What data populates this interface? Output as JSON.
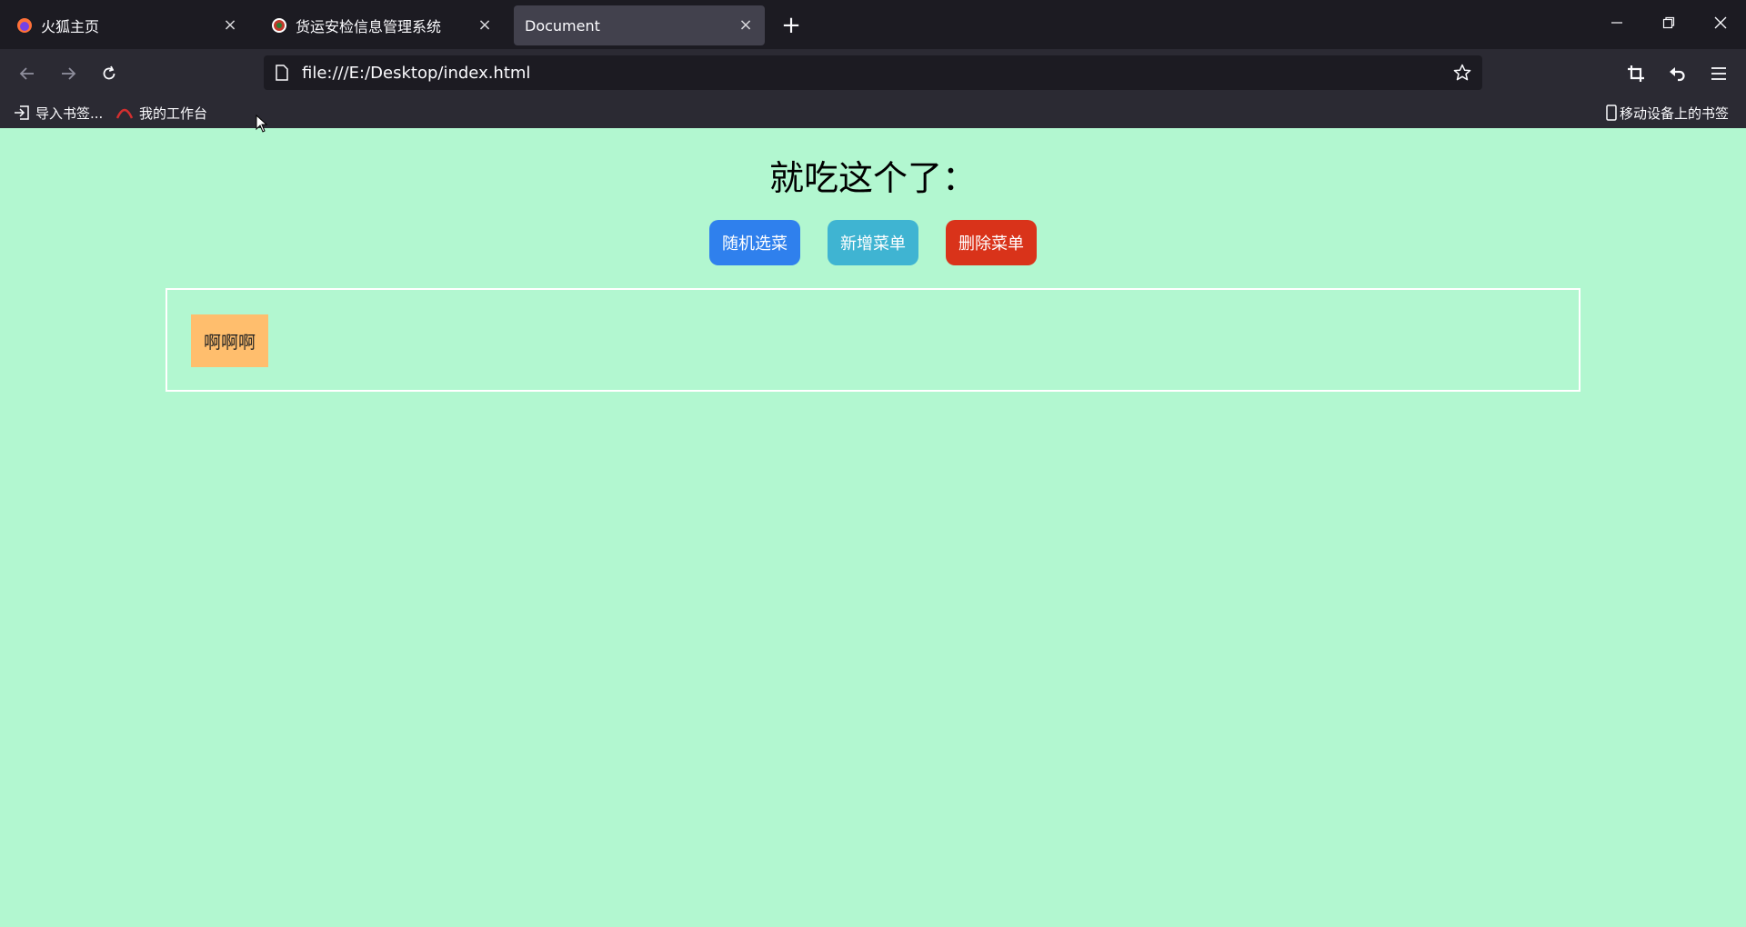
{
  "browser": {
    "tabs": [
      {
        "title": "火狐主页",
        "icon": "firefox-icon"
      },
      {
        "title": "货运安检信息管理系统",
        "icon": "site-logo-icon"
      },
      {
        "title": "Document",
        "icon": "none",
        "active": true
      }
    ],
    "url": "file:///E:/Desktop/index.html",
    "bookmarks": [
      {
        "label": "导入书签...",
        "icon": "import-icon"
      },
      {
        "label": "我的工作台",
        "icon": "workbench-icon"
      }
    ],
    "mobile_bookmarks": "移动设备上的书签"
  },
  "page": {
    "title": "就吃这个了：",
    "buttons": {
      "random": "随机选菜",
      "add": "新增菜单",
      "delete": "删除菜单"
    },
    "menu_items": [
      "啊啊啊"
    ]
  },
  "colors": {
    "page_bg": "#b2f7d0",
    "random_button": "#2f80ed",
    "add_button": "#3fb4d2",
    "delete_button": "#d9331a",
    "menu_item_bg": "#ffbe6d"
  }
}
